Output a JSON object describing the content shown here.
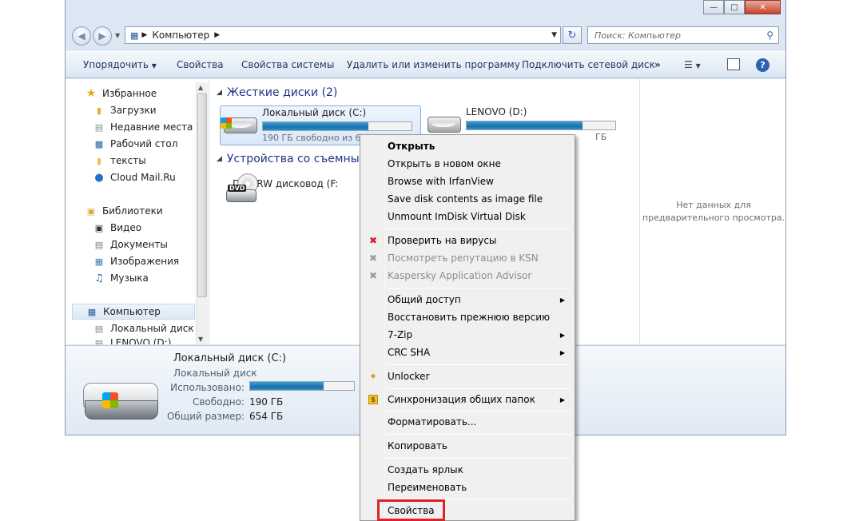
{
  "window": {
    "caption_buttons": [
      "minimize-icon",
      "maximize-icon",
      "close-icon"
    ]
  },
  "navbar": {
    "address": "Компьютер",
    "search_placeholder": "Поиск: Компьютер"
  },
  "toolbar": {
    "organize": "Упорядочить",
    "properties": "Свойства",
    "system_properties": "Свойства системы",
    "uninstall": "Удалить или изменить программу",
    "map_drive": "Подключить сетевой диск",
    "more": "»"
  },
  "sidebar": {
    "favorites_header": "Избранное",
    "favorites": [
      "Загрузки",
      "Недавние места",
      "Рабочий стол",
      "тексты",
      "Cloud Mail.Ru"
    ],
    "libraries_header": "Библиотеки",
    "libraries": [
      "Видео",
      "Документы",
      "Изображения",
      "Музыка"
    ],
    "computer_header": "Компьютер",
    "computer_items": [
      "Локальный диск (C",
      "LENOVO (D:)"
    ]
  },
  "content": {
    "hdd_group": "Жесткие диски (2)",
    "removable_group": "Устройства со съемны",
    "drive_c": {
      "name": "Локальный диск (C:)",
      "free": "190 ГБ свободно из 6",
      "used_fraction": 0.71
    },
    "drive_d": {
      "name": "LENOVO (D:)",
      "free": "ГБ",
      "used_fraction": 0.78
    },
    "dvd": {
      "name": "DVD RW дисковод (F:",
      "label": "DVD"
    }
  },
  "preview": {
    "text_line1": "Нет данных для",
    "text_line2": "предварительного просмотра."
  },
  "details": {
    "name": "Локальный диск (C:)",
    "type": "Локальный диск",
    "used_label": "Использовано:",
    "free_label": "Свободно:",
    "free_value": "190 ГБ",
    "total_label": "Общий размер:",
    "total_value": "654 ГБ",
    "used_fraction": 0.71
  },
  "context_menu": {
    "items": [
      "Открыть",
      "Открыть в новом окне",
      "Browse with IrfanView",
      "Save disk contents as image file",
      "Unmount ImDisk Virtual Disk",
      "Проверить на вирусы",
      "Посмотреть репутацию в KSN",
      "Kaspersky Application Advisor",
      "Общий доступ",
      "Восстановить прежнюю версию",
      "7-Zip",
      "CRC SHA",
      "Unlocker",
      "Синхронизация общих папок",
      "Форматировать...",
      "Копировать",
      "Создать ярлык",
      "Переименовать",
      "Свойства"
    ],
    "highlight_color": "#e0202a"
  }
}
